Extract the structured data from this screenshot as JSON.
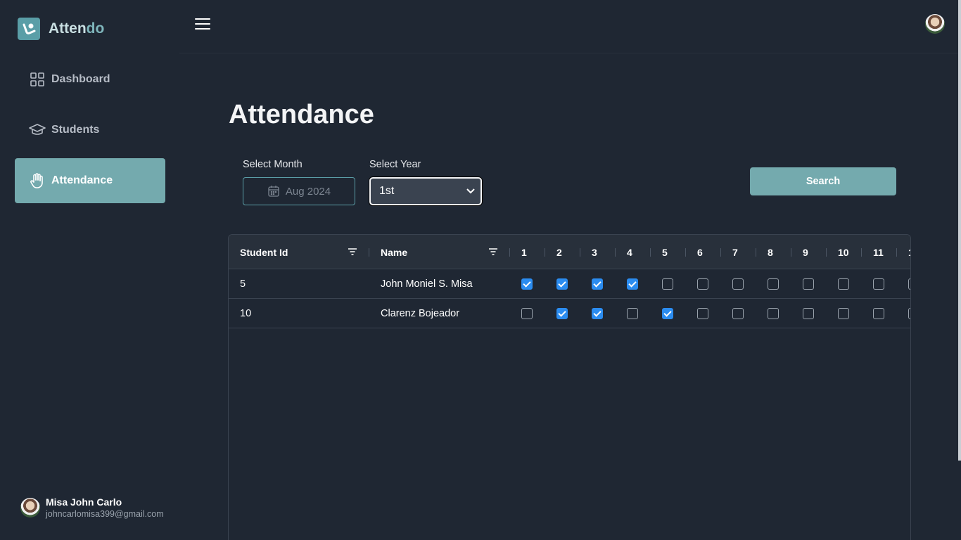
{
  "app": {
    "name_a": "Atten",
    "name_b": "do"
  },
  "sidebar": {
    "items": [
      {
        "label": "Dashboard",
        "icon": "grid-icon",
        "active": false
      },
      {
        "label": "Students",
        "icon": "graduation-cap-icon",
        "active": false
      },
      {
        "label": "Attendance",
        "icon": "hand-icon",
        "active": true
      }
    ],
    "user": {
      "name": "Misa John Carlo",
      "email": "johncarlomisa399@gmail.com"
    }
  },
  "header": {
    "menu_icon": "hamburger-icon"
  },
  "main": {
    "title": "Attendance",
    "month_label": "Select Month",
    "month_value": "Aug 2024",
    "year_label": "Select Year",
    "year_value": "1st",
    "search_label": "Search"
  },
  "table": {
    "headers": {
      "id": "Student Id",
      "name": "Name"
    },
    "days": [
      "1",
      "2",
      "3",
      "4",
      "5",
      "6",
      "7",
      "8",
      "9",
      "10",
      "11",
      "1"
    ],
    "rows": [
      {
        "id": "5",
        "name": "John Moniel S. Misa",
        "checks": [
          true,
          true,
          true,
          true,
          false,
          false,
          false,
          false,
          false,
          false,
          false,
          false
        ]
      },
      {
        "id": "10",
        "name": "Clarenz Bojeador",
        "checks": [
          false,
          true,
          true,
          false,
          true,
          false,
          false,
          false,
          false,
          false,
          false,
          false
        ]
      }
    ]
  },
  "colors": {
    "accent": "#74aaae",
    "checkbox": "#2b8cf0",
    "background": "#1f2733"
  }
}
